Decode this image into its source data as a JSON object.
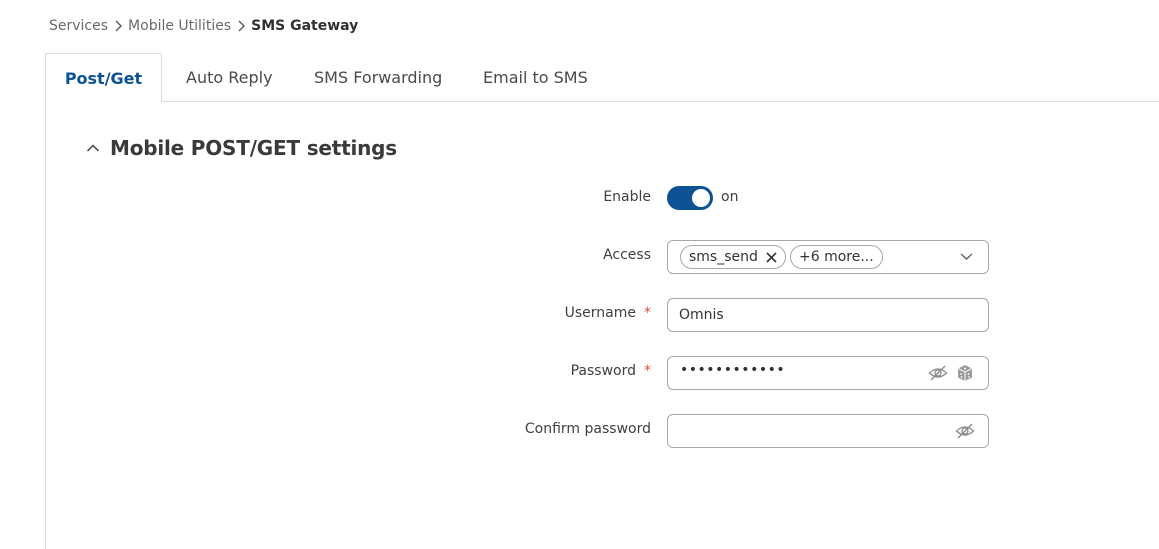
{
  "breadcrumb": {
    "items": [
      "Services",
      "Mobile Utilities",
      "SMS Gateway"
    ]
  },
  "tabs": [
    "Post/Get",
    "Auto Reply",
    "SMS Forwarding",
    "Email to SMS"
  ],
  "section": {
    "title": "Mobile POST/GET settings"
  },
  "form": {
    "enable": {
      "label": "Enable",
      "state": "on",
      "checked": true
    },
    "access": {
      "label": "Access",
      "chip": "sms_send",
      "more": "+6 more..."
    },
    "username": {
      "label": "Username",
      "required": "*",
      "value": "Omnis"
    },
    "password": {
      "label": "Password",
      "required": "*",
      "masked": "••••••••••••"
    },
    "confirm_password": {
      "label": "Confirm password",
      "value": ""
    }
  },
  "colors": {
    "accent": "#0e5296",
    "required": "#e34b4b",
    "border": "#dcdcdc"
  },
  "icons": {
    "breadcrumb_separator": "chevron-right-icon",
    "section_toggle": "chevron-up-icon",
    "access_dropdown": "chevron-down-icon",
    "chip_remove": "close-icon",
    "password_visibility": "eye-slash-icon",
    "password_generate": "dice-icon"
  }
}
